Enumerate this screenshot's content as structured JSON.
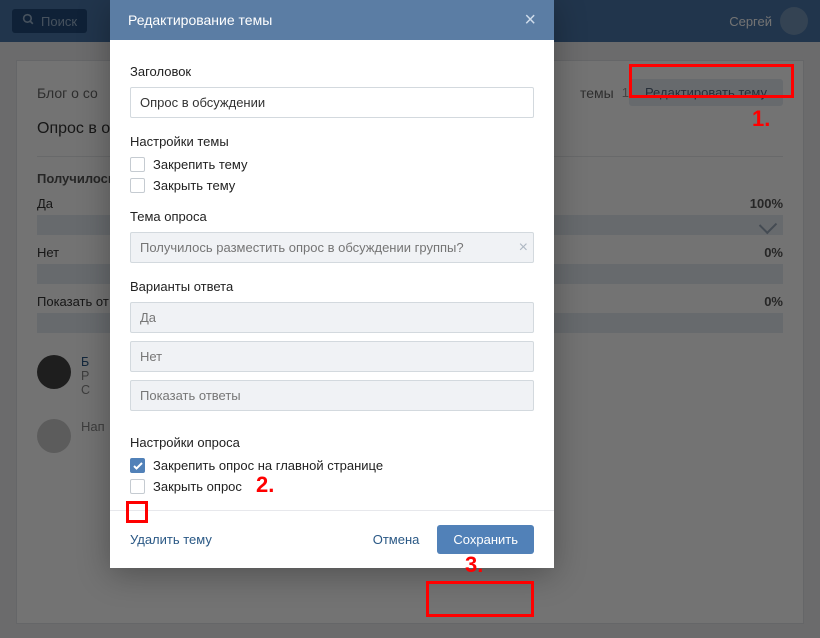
{
  "header": {
    "search_placeholder": "Поиск",
    "username": "Сергей"
  },
  "page": {
    "breadcrumb": "Блог о со",
    "topic_suffix": "темы",
    "topic_count": "1",
    "edit_topic_btn": "Редактировать тему",
    "topic_title": "Опрос в о",
    "poll_title": "Получилось",
    "options": [
      {
        "label": "Да",
        "pct": "100%",
        "full": true
      },
      {
        "label": "Нет",
        "pct": "0%",
        "full": false
      }
    ],
    "show_answers_label": "Показать от",
    "show_answers_pct": "0%",
    "comment_author": "Б",
    "comment_input": "Нап"
  },
  "modal": {
    "title": "Редактирование темы",
    "label_heading": "Заголовок",
    "heading_value": "Опрос в обсуждении",
    "label_topic_settings": "Настройки темы",
    "pin_topic": "Закрепить тему",
    "close_topic": "Закрыть тему",
    "label_poll_topic": "Тема опроса",
    "poll_topic_placeholder": "Получилось разместить опрос в обсуждении группы?",
    "label_answers": "Варианты ответа",
    "answer_options": [
      "Да",
      "Нет",
      "Показать ответы"
    ],
    "label_poll_settings": "Настройки опроса",
    "pin_poll": "Закрепить опрос на главной странице",
    "close_poll": "Закрыть опрос",
    "delete_link": "Удалить тему",
    "cancel": "Отмена",
    "save": "Сохранить"
  },
  "annotations": {
    "n1": "1.",
    "n2": "2.",
    "n3": "3."
  }
}
